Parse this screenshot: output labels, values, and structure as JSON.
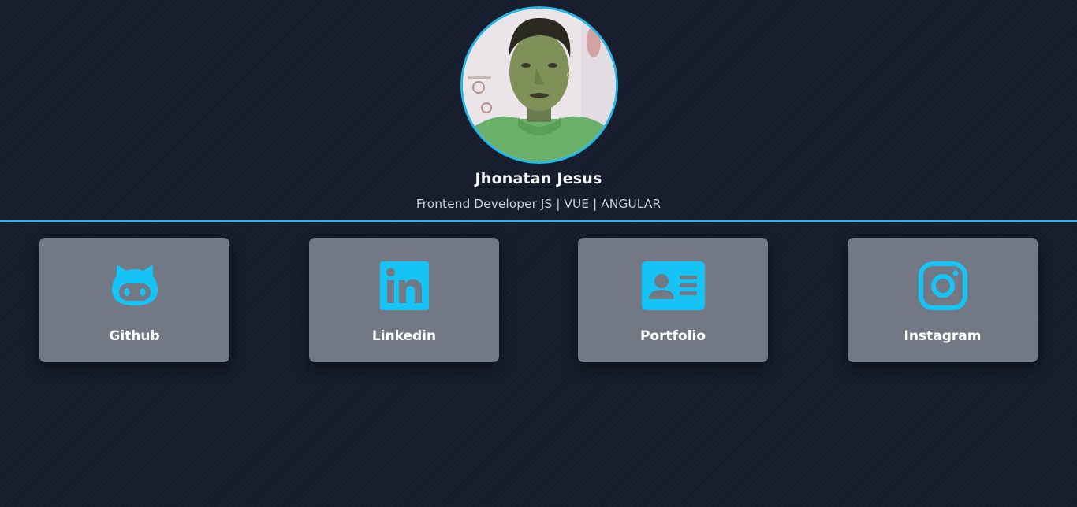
{
  "profile": {
    "name": "Jhonatan Jesus",
    "role": "Frontend Developer JS | VUE | ANGULAR",
    "avatar_icon": "profile-photo"
  },
  "links": [
    {
      "label": "Github",
      "icon": "github-icon"
    },
    {
      "label": "Linkedin",
      "icon": "linkedin-icon"
    },
    {
      "label": "Portfolio",
      "icon": "id-card-icon"
    },
    {
      "label": "Instagram",
      "icon": "instagram-icon"
    }
  ],
  "colors": {
    "background": "#151c2b",
    "accent": "#1fb8e8",
    "card": "#727985",
    "icon": "#16c3f5",
    "text": "#ffffff"
  }
}
